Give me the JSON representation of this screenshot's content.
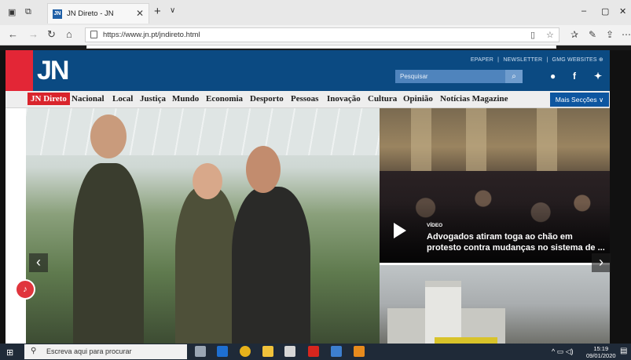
{
  "browser": {
    "tab_title": "JN Direto - JN",
    "tab_favicon_text": "JN",
    "url": "https://www.jn.pt/jndireto.html",
    "window_controls": {
      "minimize": "–",
      "maximize": "▢",
      "close": "✕"
    }
  },
  "site": {
    "logo_text": "JN",
    "top_links": [
      "EPAPER",
      "|",
      "NEWSLETTER",
      "|",
      "GMG WEBSITES ⊕"
    ],
    "search_placeholder": "Pesquisar",
    "menu": [
      "JN Direto",
      "Nacional",
      "Local",
      "Justiça",
      "Mundo",
      "Economia",
      "Desporto",
      "Pessoas",
      "Inovação",
      "Cultura",
      "Opinião",
      "Notícias Magazine"
    ],
    "more_sections": "Mais Secções ∨",
    "social_icons": [
      "user-icon",
      "facebook-icon",
      "twitter-icon"
    ]
  },
  "content": {
    "video_label": "VÍDEO",
    "video_title": "Advogados atiram toga ao chão em protesto contra mudanças no sistema de ...",
    "prev_arrow": "‹",
    "next_arrow": "›"
  },
  "taskbar": {
    "search_placeholder": "Escreva aqui para procurar",
    "time": "15:19",
    "date": "09/01/2020"
  },
  "colors": {
    "header_blue": "#0b4a82",
    "brand_red": "#e32636",
    "menu_active": "#d9242c"
  }
}
